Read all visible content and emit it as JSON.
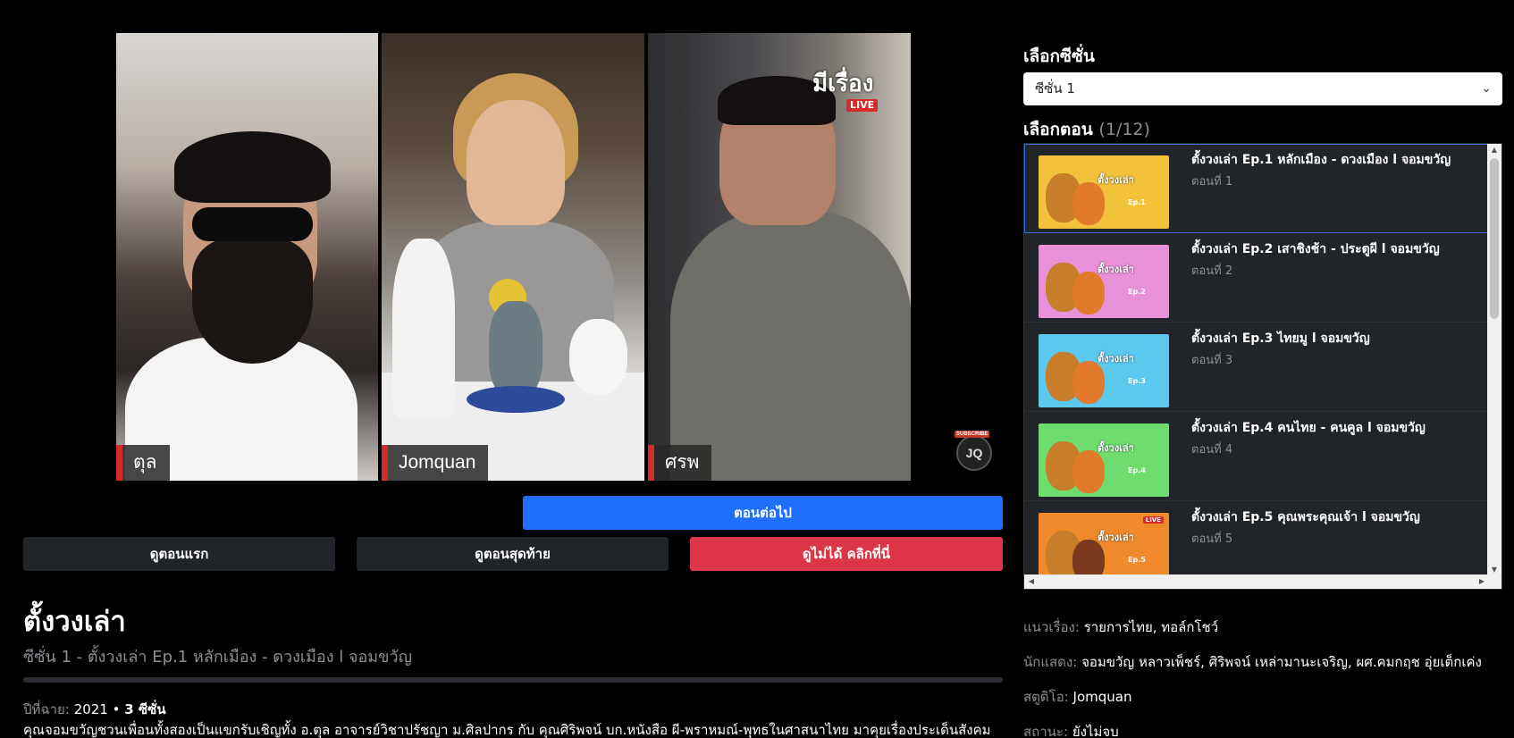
{
  "player": {
    "participants": [
      "ตุล",
      "Jomquan",
      "ศรพ"
    ],
    "brand_logo": "มีเรื่อง",
    "brand_live": "LIVE",
    "subscribe_badge": "JQ",
    "subscribe_label": "SUBSCRIBE"
  },
  "controls": {
    "next_label": "ตอนต่อไป",
    "first_label": "ดูตอนแรก",
    "last_label": "ดูตอนสุดท้าย",
    "problem_label": "ดูไม่ได้ คลิกที่นี่"
  },
  "show": {
    "title": "ตั้งวงเล่า",
    "subtitle": "ซีซั่น 1 - ตั้งวงเล่า Ep.1 หลักเมือง - ดวงเมือง l จอมขวัญ",
    "year_label": "ปีที่ฉาย:",
    "year": "2021",
    "season_count": "3 ซีซั่น",
    "description": "คุณจอมขวัญชวนเพื่อนทั้งสองเป็นแขกรับเชิญทั้ง อ.ตุล อาจารย์วิชาปรัชญา ม.ศิลปากร กับ คุณศิริพจน์ บก.หนังสือ ผี-พราหมณ์-พุทธในศาสนาไทย มาคุยเรื่องประเด็นสังคม"
  },
  "season_picker": {
    "heading": "เลือกซีซั่น",
    "selected": "ซีซั่น 1"
  },
  "episode_picker": {
    "heading": "เลือกตอน",
    "count": "(1/12)",
    "episodes": [
      {
        "title": "ตั้งวงเล่า Ep.1 หลักเมือง - ดวงเมือง l จอมขวัญ",
        "sub": "ตอนที่ 1",
        "thumb_bg": "#f2c23a",
        "thumb_caption": "ตั้งวงเล่า",
        "thumb_ep": "Ep.1"
      },
      {
        "title": "ตั้งวงเล่า Ep.2 เสาชิงช้า - ประตูผี l จอมขวัญ",
        "sub": "ตอนที่ 2",
        "thumb_bg": "#e890d8",
        "thumb_caption": "ตั้งวงเล่า",
        "thumb_ep": "Ep.2"
      },
      {
        "title": "ตั้งวงเล่า Ep.3 ไทยมู l จอมขวัญ",
        "sub": "ตอนที่ 3",
        "thumb_bg": "#5cc8ee",
        "thumb_caption": "ตั้งวงเล่า",
        "thumb_ep": "Ep.3"
      },
      {
        "title": "ตั้งวงเล่า Ep.4 คนไทย - คนคูล l จอมขวัญ",
        "sub": "ตอนที่ 4",
        "thumb_bg": "#6fdc70",
        "thumb_caption": "ตั้งวงเล่า",
        "thumb_ep": "Ep.4"
      },
      {
        "title": "ตั้งวงเล่า Ep.5 คุณพระคุณเจ้า l จอมขวัญ",
        "sub": "ตอนที่ 5",
        "thumb_bg": "#f08a2a",
        "thumb_caption": "ตั้งวงเล่า",
        "thumb_ep": "Ep.5",
        "thumb_live": "LIVE"
      }
    ]
  },
  "info": {
    "genre_label": "แนวเรื่อง:",
    "genre": "รายการไทย, ทอล์กโชว์",
    "cast_label": "นักแสดง:",
    "cast": "จอมขวัญ หลาวเพ็ชร์, ศิริพจน์ เหล่ามานะเจริญ, ผศ.คมกฤช อุ่ยเต็กเค่ง",
    "studio_label": "สตูดิโอ:",
    "studio": "Jomquan",
    "status_label": "สถานะ:",
    "status": "ยังไม่จบ"
  },
  "colors": {
    "primary": "#1f6ffb",
    "danger": "#dc3545",
    "dark_button": "#212529",
    "muted_text": "#8c8f94"
  }
}
